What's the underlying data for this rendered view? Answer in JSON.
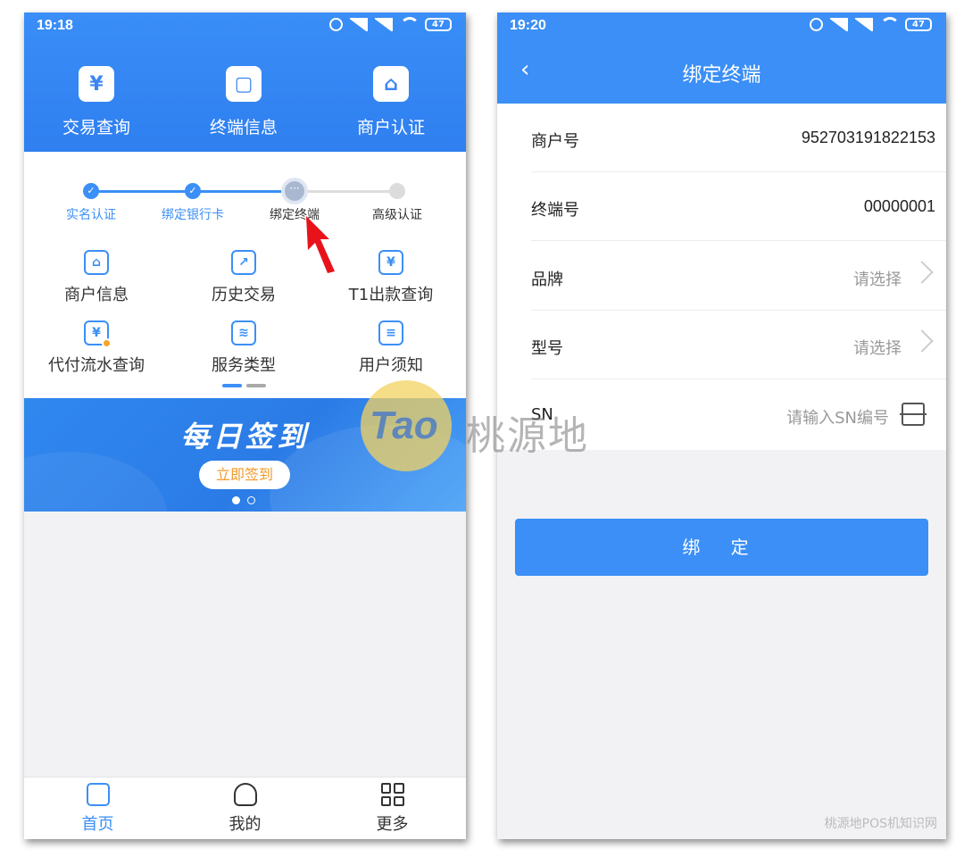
{
  "left": {
    "status": {
      "time": "19:18",
      "battery": "47"
    },
    "header_items": [
      {
        "label": "交易查询",
        "icon": "yuan-search-icon",
        "glyph": "¥"
      },
      {
        "label": "终端信息",
        "icon": "terminal-icon",
        "glyph": "▢"
      },
      {
        "label": "商户认证",
        "icon": "store-verify-icon",
        "glyph": "⌂"
      }
    ],
    "steps": [
      {
        "label": "实名认证",
        "state": "done"
      },
      {
        "label": "绑定银行卡",
        "state": "done"
      },
      {
        "label": "绑定终端",
        "state": "current"
      },
      {
        "label": "高级认证",
        "state": "todo"
      }
    ],
    "grid": [
      {
        "label": "商户信息",
        "icon": "store-search-icon",
        "glyph": "⌂"
      },
      {
        "label": "历史交易",
        "icon": "history-trade-icon",
        "glyph": "↗"
      },
      {
        "label": "T1出款查询",
        "icon": "t1-payout-icon",
        "glyph": "¥"
      },
      {
        "label": "代付流水查询",
        "icon": "payment-flow-icon",
        "glyph": "¥"
      },
      {
        "label": "服务类型",
        "icon": "service-layers-icon",
        "glyph": "≋"
      },
      {
        "label": "用户须知",
        "icon": "user-notice-icon",
        "glyph": "≡"
      }
    ],
    "banner": {
      "title": "每日签到",
      "button": "立即签到"
    },
    "tabs": [
      {
        "label": "首页",
        "icon": "home-icon"
      },
      {
        "label": "我的",
        "icon": "user-icon"
      },
      {
        "label": "更多",
        "icon": "more-grid-icon"
      }
    ]
  },
  "right": {
    "status": {
      "time": "19:20",
      "battery": "47"
    },
    "title": "绑定终端",
    "rows": [
      {
        "label": "商户号",
        "value": "952703191822153"
      },
      {
        "label": "终端号",
        "value": "00000001"
      },
      {
        "label": "品牌",
        "placeholder": "请选择"
      },
      {
        "label": "型号",
        "placeholder": "请选择"
      },
      {
        "label": "SN",
        "placeholder": "请输入SN编号"
      }
    ],
    "bind_button": "绑 定"
  },
  "watermark": {
    "tao": "Tao",
    "cn": "桃源地",
    "corner": "桃源地POS机知识网"
  },
  "colors": {
    "primary": "#3b8ff6",
    "orange": "#f39a2a",
    "arrow": "#e8131a"
  }
}
